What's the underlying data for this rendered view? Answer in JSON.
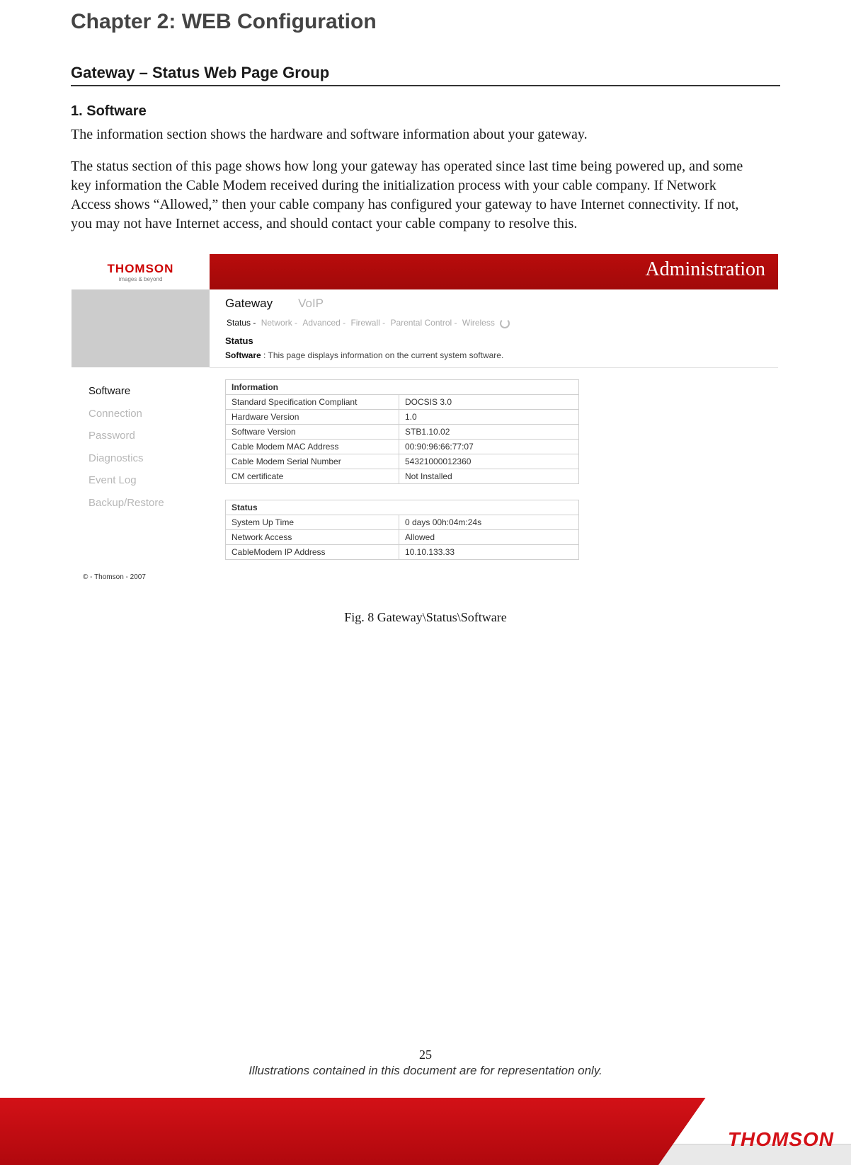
{
  "chapterTitle": "Chapter 2: WEB Configuration",
  "sectionTitle": "Gateway – Status Web Page Group",
  "subTitle": "1. Software",
  "para1": "The information section shows the hardware and software information about your gateway.",
  "para2": "The status section of this page shows how long your gateway has operated since last time being powered up, and some key information the Cable Modem received during the initialization process with your cable company. If Network Access shows “Allowed,” then your cable company has configured your gateway to have Internet connectivity. If not, you may not have Internet access, and should contact your cable company to resolve this.",
  "figCaption": "Fig. 8 Gateway\\Status\\Software",
  "pageNumber": "25",
  "disclaimer": "Illustrations contained in this document are for representation only.",
  "footerBrand": "THOMSON",
  "screenshot": {
    "brand": "THOMSON",
    "tagline": "images & beyond",
    "headerTitle": "Administration",
    "mainTabs": {
      "gateway": "Gateway",
      "voip": "VoIP"
    },
    "subTabs": {
      "status": "Status -",
      "network": "Network -",
      "advanced": "Advanced -",
      "firewall": "Firewall -",
      "parental": "Parental Control -",
      "wireless": "Wireless"
    },
    "sidebar": [
      "Software",
      "Connection",
      "Password",
      "Diagnostics",
      "Event Log",
      "Backup/Restore"
    ],
    "statusHeading": "Status",
    "softwareLabel": "Software",
    "softwareDesc": ":  This page displays information on the current system software.",
    "infoTable": {
      "title": "Information",
      "rows": [
        {
          "k": "Standard Specification Compliant",
          "v": "DOCSIS 3.0"
        },
        {
          "k": "Hardware Version",
          "v": "1.0"
        },
        {
          "k": "Software Version",
          "v": "STB1.10.02"
        },
        {
          "k": "Cable Modem MAC Address",
          "v": "00:90:96:66:77:07"
        },
        {
          "k": "Cable Modem Serial Number",
          "v": "54321000012360"
        },
        {
          "k": "CM certificate",
          "v": "Not Installed"
        }
      ]
    },
    "statusTable": {
      "title": "Status",
      "rows": [
        {
          "k": "System Up Time",
          "v": "0 days 00h:04m:24s"
        },
        {
          "k": "Network Access",
          "v": "Allowed"
        },
        {
          "k": "CableModem IP Address",
          "v": "10.10.133.33"
        }
      ]
    },
    "copyright": "© - Thomson - 2007"
  }
}
